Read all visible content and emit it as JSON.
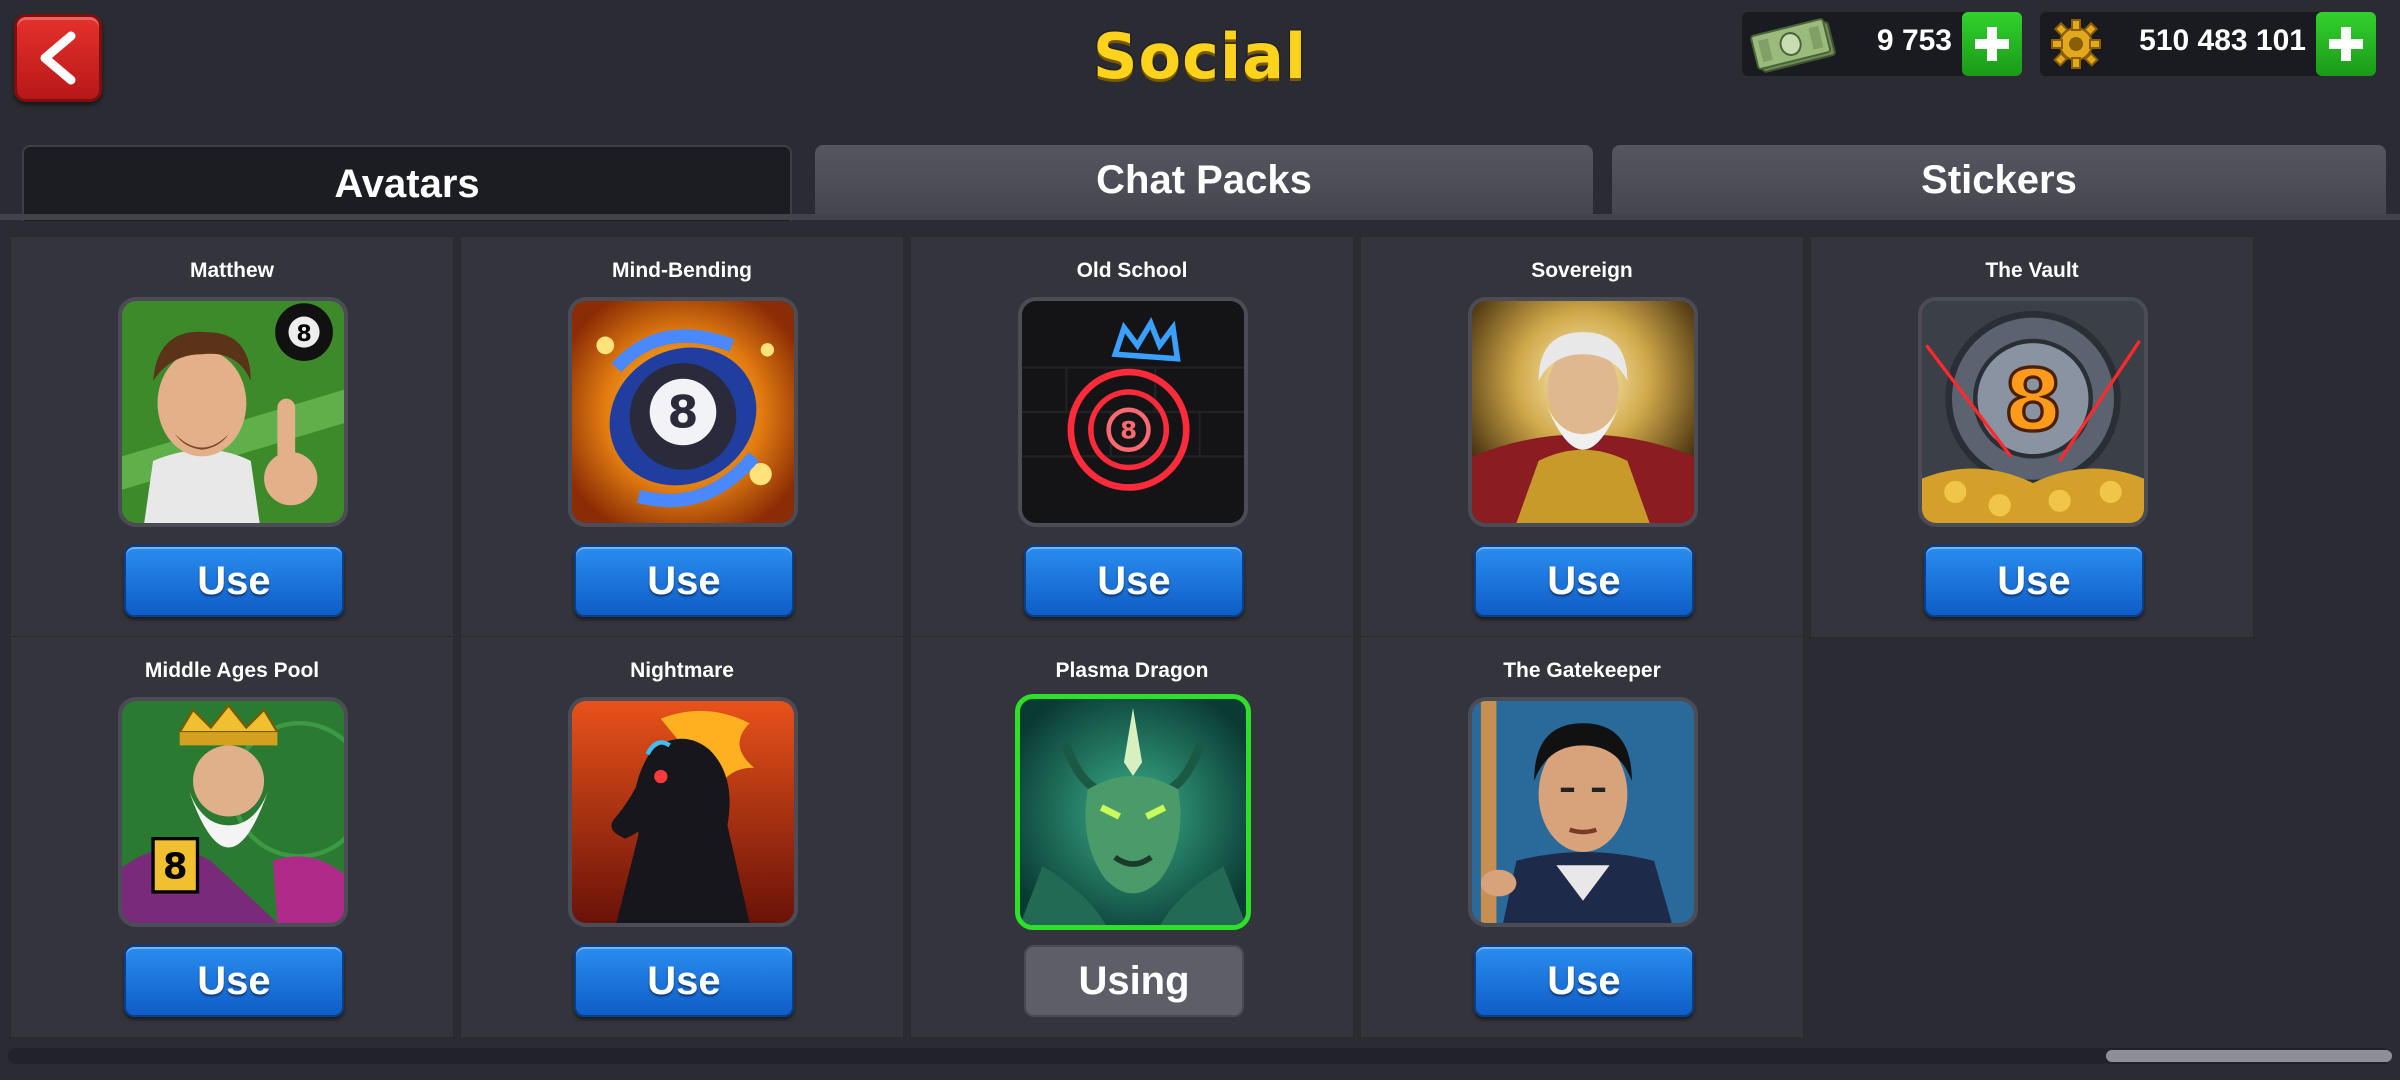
{
  "header": {
    "title": "Social",
    "back_icon": "chevron-left-icon",
    "cash": {
      "value": "9 753",
      "icon": "banknote-icon"
    },
    "coins": {
      "value": "510 483 101",
      "icon": "gear-coin-icon"
    }
  },
  "tabs": [
    {
      "label": "Avatars",
      "active": true
    },
    {
      "label": "Chat Packs",
      "active": false
    },
    {
      "label": "Stickers",
      "active": false
    }
  ],
  "avatars": [
    {
      "name": "Matthew",
      "button": "Use"
    },
    {
      "name": "Mind-Bending",
      "button": "Use"
    },
    {
      "name": "Old School",
      "button": "Use"
    },
    {
      "name": "Sovereign",
      "button": "Use"
    },
    {
      "name": "The Vault",
      "button": "Use"
    },
    {
      "name": "Middle Ages Pool",
      "button": "Use"
    },
    {
      "name": "Nightmare",
      "button": "Use"
    },
    {
      "name": "Plasma Dragon",
      "button": "Using"
    },
    {
      "name": "The Gatekeeper",
      "button": "Use"
    }
  ],
  "colors": {
    "accent_title": "#ffd21c",
    "use_button": "#1a74de",
    "selected_border": "#2ee02a",
    "plus_button": "#2bbf27",
    "back_button": "#d0241f"
  }
}
